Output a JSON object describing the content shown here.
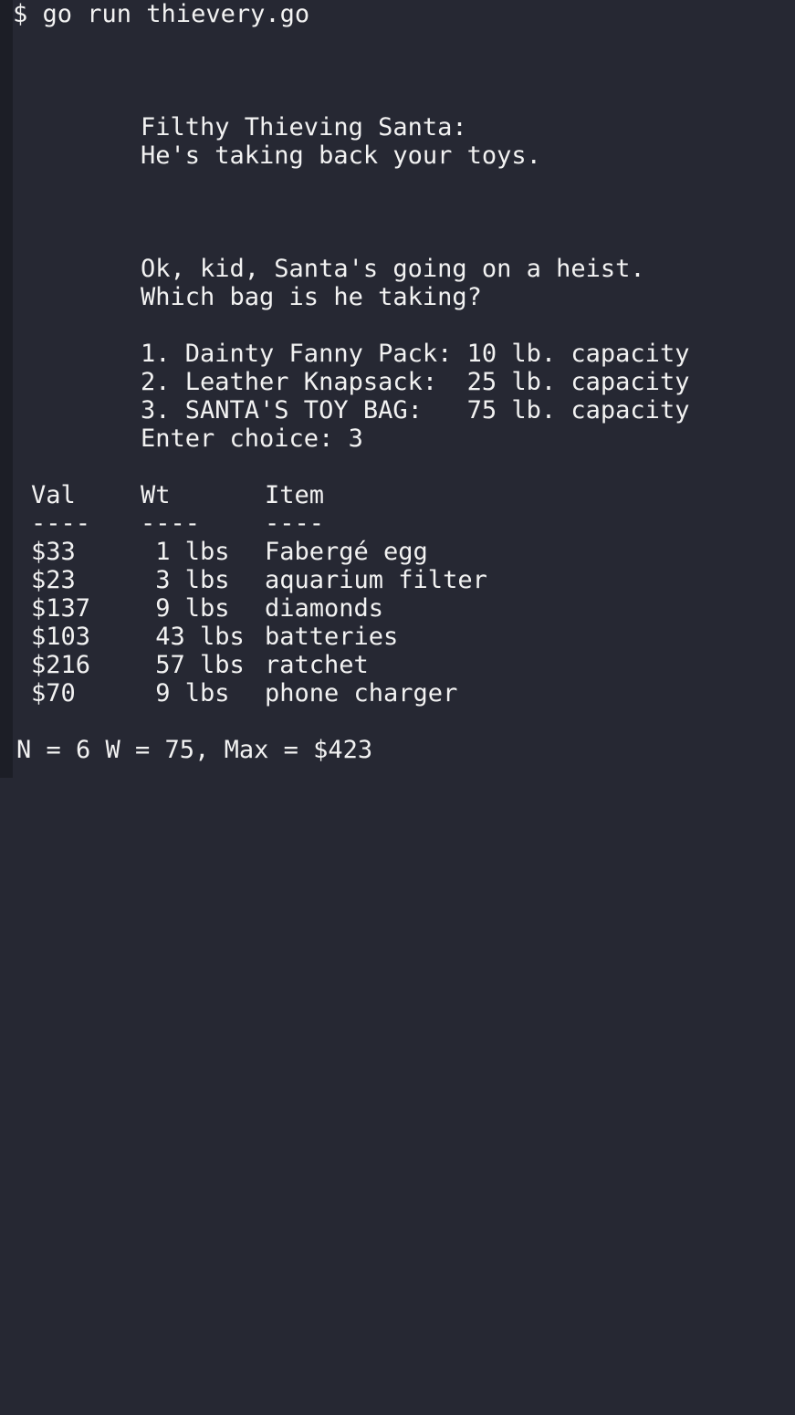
{
  "terminal": {
    "command": "$ go run thievery.go",
    "banner": [
      "Filthy Thieving Santa:",
      "He's taking back your toys."
    ],
    "prompt": [
      "Ok, kid, Santa's going on a heist.",
      "Which bag is he taking?"
    ],
    "options": [
      "1. Dainty Fanny Pack: 10 lb. capacity",
      "2. Leather Knapsack:  25 lb. capacity",
      "3. SANTA'S TOY BAG:   75 lb. capacity"
    ],
    "choice": "Enter choice: 3",
    "table": {
      "headers": {
        "val": "Val",
        "wt": "Wt",
        "item": "Item"
      },
      "separators": {
        "val": "----",
        "wt": "----",
        "item": "----"
      },
      "rows": [
        {
          "val": "$33",
          "wt": " 1 lbs",
          "item": "Fabergé egg"
        },
        {
          "val": "$23",
          "wt": " 3 lbs",
          "item": "aquarium filter"
        },
        {
          "val": "$137",
          "wt": " 9 lbs",
          "item": "diamonds"
        },
        {
          "val": "$103",
          "wt": " 43 lbs",
          "item": "batteries"
        },
        {
          "val": "$216",
          "wt": " 57 lbs",
          "item": "ratchet"
        },
        {
          "val": "$70",
          "wt": " 9 lbs",
          "item": "phone charger"
        }
      ]
    },
    "result": "N = 6 W = 75, Max = $423"
  }
}
